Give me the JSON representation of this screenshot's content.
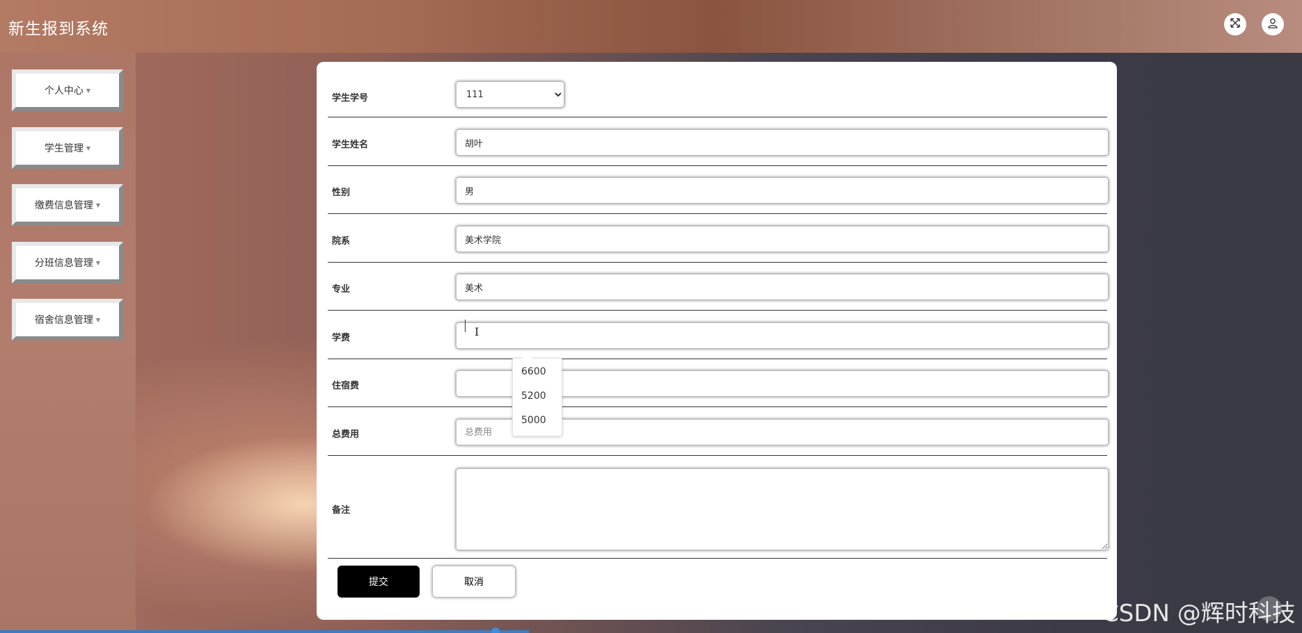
{
  "header": {
    "title": "新生报到系统",
    "fullscreen_icon": "expand-arrows-icon",
    "user_icon": "user-icon"
  },
  "sidebar": {
    "items": [
      {
        "label": "个人中心"
      },
      {
        "label": "学生管理"
      },
      {
        "label": "缴费信息管理"
      },
      {
        "label": "分班信息管理"
      },
      {
        "label": "宿舍信息管理"
      }
    ]
  },
  "form": {
    "student_id": {
      "label": "学生学号",
      "value": "111"
    },
    "student_name": {
      "label": "学生姓名",
      "value": "胡叶"
    },
    "gender": {
      "label": "性别",
      "value": "男"
    },
    "department": {
      "label": "院系",
      "value": "美术学院"
    },
    "major": {
      "label": "专业",
      "value": "美术"
    },
    "tuition": {
      "label": "学费",
      "value": ""
    },
    "accommodation_fee": {
      "label": "住宿费",
      "value": ""
    },
    "total_fee": {
      "label": "总费用",
      "value": "",
      "placeholder": "总费用"
    },
    "remarks": {
      "label": "备注",
      "value": ""
    }
  },
  "autocomplete": {
    "options": [
      "6600",
      "5200",
      "5000"
    ]
  },
  "buttons": {
    "submit": "提交",
    "cancel": "取消"
  },
  "watermark": "CSDN @辉时科技",
  "colors": {
    "header_start": "#b37a64",
    "header_mid": "#8a5440",
    "sidebar": "#ad7767",
    "submit_bg": "#000000"
  }
}
